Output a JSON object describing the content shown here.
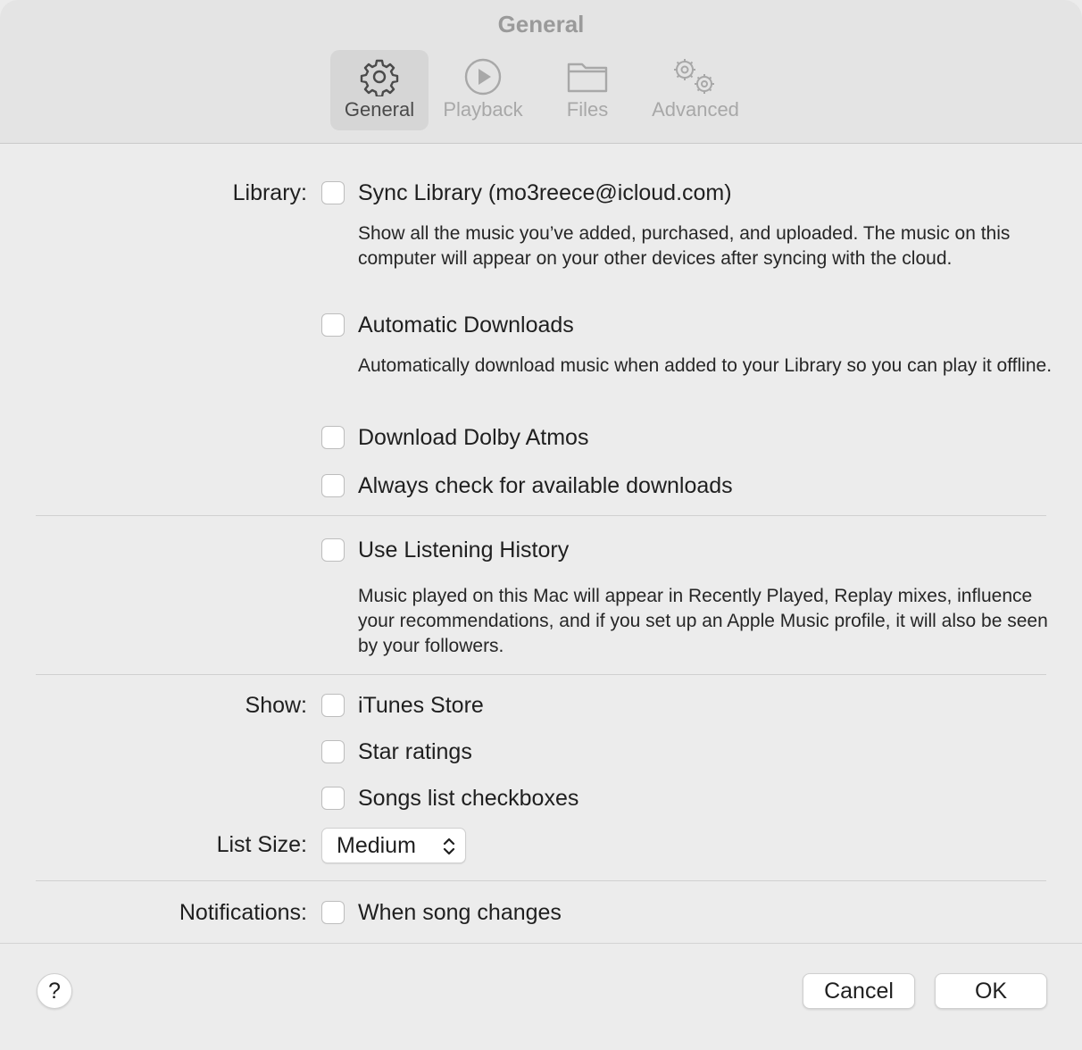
{
  "window": {
    "title": "General"
  },
  "tabs": [
    {
      "label": "General",
      "icon": "gear-icon",
      "active": true
    },
    {
      "label": "Playback",
      "icon": "play-circle-icon",
      "active": false
    },
    {
      "label": "Files",
      "icon": "folder-icon",
      "active": false
    },
    {
      "label": "Advanced",
      "icon": "gears-icon",
      "active": false
    }
  ],
  "library": {
    "label": "Library:",
    "sync_library": {
      "label": "Sync Library (mo3reece@icloud.com)",
      "checked": false,
      "description": "Show all the music you’ve added, purchased, and uploaded. The music on this computer will appear on your other devices after syncing with the cloud."
    },
    "automatic_downloads": {
      "label": "Automatic Downloads",
      "checked": false,
      "description": "Automatically download music when added to your Library so you can play it offline."
    },
    "download_dolby_atmos": {
      "label": "Download Dolby Atmos",
      "checked": false
    },
    "always_check_downloads": {
      "label": "Always check for available downloads",
      "checked": false
    }
  },
  "listening_history": {
    "label": "Use Listening History",
    "checked": false,
    "description": "Music played on this Mac will appear in Recently Played, Replay mixes, influence your recommendations, and if you set up an Apple Music profile, it will also be seen by your followers."
  },
  "show": {
    "label": "Show:",
    "itunes_store": {
      "label": "iTunes Store",
      "checked": false
    },
    "star_ratings": {
      "label": "Star ratings",
      "checked": false
    },
    "songs_list_checkboxes": {
      "label": "Songs list checkboxes",
      "checked": false
    }
  },
  "list_size": {
    "label": "List Size:",
    "value": "Medium"
  },
  "notifications": {
    "label": "Notifications:",
    "when_song_changes": {
      "label": "When song changes",
      "checked": false
    }
  },
  "footer": {
    "help_label": "?",
    "cancel_label": "Cancel",
    "ok_label": "OK"
  }
}
